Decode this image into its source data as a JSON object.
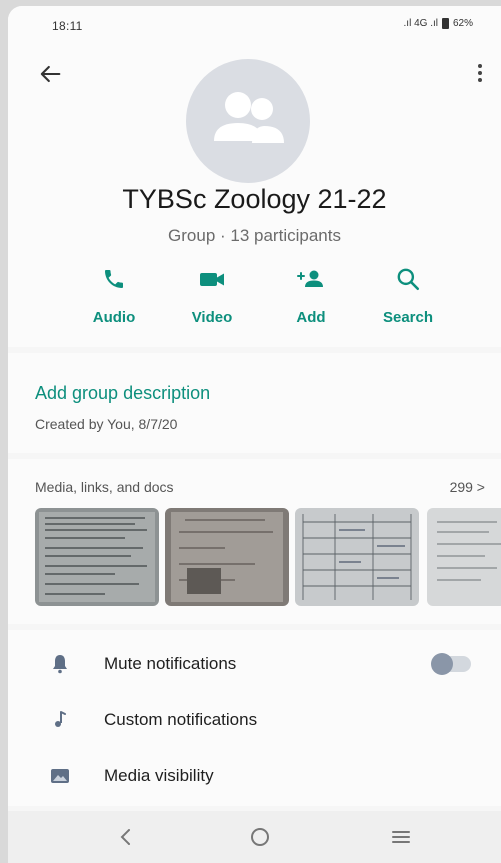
{
  "status_bar": {
    "time": "18:11",
    "signal_text": ".ıl 4G .ıl",
    "battery": "62%"
  },
  "header": {
    "back_icon": "arrow-left-icon",
    "menu_icon": "more-vertical-icon"
  },
  "group": {
    "name": "TYBSc Zoology 21-22",
    "subtitle": "Group · 13 participants",
    "avatar_icon": "group-avatar-icon"
  },
  "actions": [
    {
      "label": "Audio",
      "icon": "phone-icon"
    },
    {
      "label": "Video",
      "icon": "video-camera-icon"
    },
    {
      "label": "Add",
      "icon": "add-person-icon"
    },
    {
      "label": "Search",
      "icon": "search-icon"
    }
  ],
  "description": {
    "title": "Add group description",
    "created": "Created by You, 8/7/20"
  },
  "media": {
    "title": "Media, links, and docs",
    "count": "299 >"
  },
  "settings": [
    {
      "label": "Mute notifications",
      "icon": "bell-icon",
      "toggle": false
    },
    {
      "label": "Custom notifications",
      "icon": "music-note-icon"
    },
    {
      "label": "Media visibility",
      "icon": "image-icon"
    }
  ],
  "colors": {
    "accent": "#0d8f7d",
    "background": "#f6f6f6"
  }
}
